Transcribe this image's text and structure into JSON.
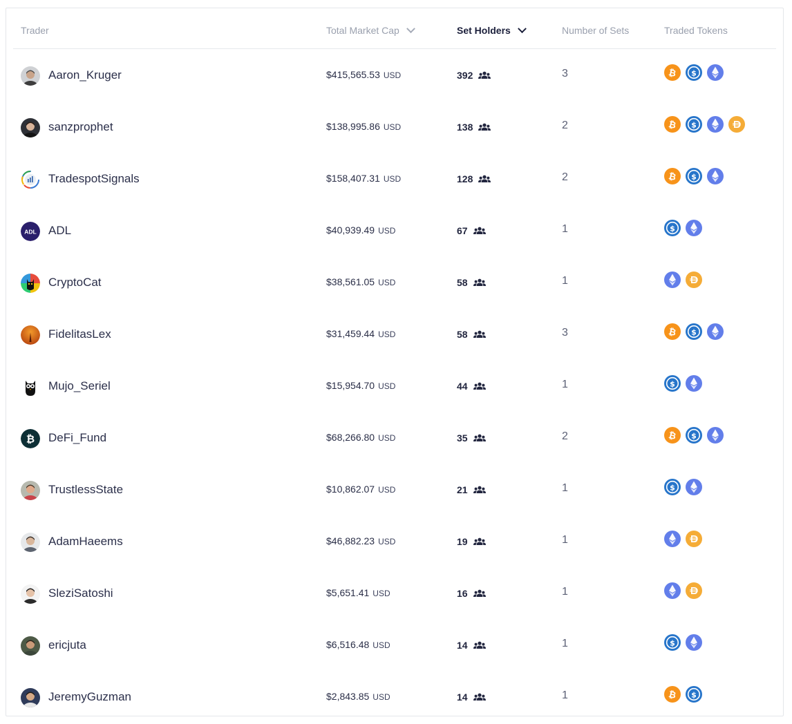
{
  "table": {
    "headers": {
      "trader": "Trader",
      "total_market_cap": "Total Market Cap",
      "set_holders": "Set Holders",
      "number_of_sets": "Number of Sets",
      "traded_tokens": "Traded Tokens"
    },
    "sort_column": "Set Holders",
    "currency_label": "USD",
    "rows": [
      {
        "trader": "Aaron_Kruger",
        "market_cap": "$415,565.53",
        "holders": "392",
        "sets": "3",
        "tokens": [
          "btc",
          "usdc",
          "eth"
        ],
        "avatar": "photo-gray"
      },
      {
        "trader": "sanzprophet",
        "market_cap": "$138,995.86",
        "holders": "138",
        "sets": "2",
        "tokens": [
          "btc",
          "usdc",
          "eth",
          "dai"
        ],
        "avatar": "photo-dark"
      },
      {
        "trader": "TradespotSignals",
        "market_cap": "$158,407.31",
        "holders": "128",
        "sets": "2",
        "tokens": [
          "btc",
          "usdc",
          "eth"
        ],
        "avatar": "ring-logo"
      },
      {
        "trader": "ADL",
        "market_cap": "$40,939.49",
        "holders": "67",
        "sets": "1",
        "tokens": [
          "usdc",
          "eth"
        ],
        "avatar": "adl-logo"
      },
      {
        "trader": "CryptoCat",
        "market_cap": "$38,561.05",
        "holders": "58",
        "sets": "1",
        "tokens": [
          "eth",
          "dai"
        ],
        "avatar": "cat-logo"
      },
      {
        "trader": "FidelitasLex",
        "market_cap": "$31,459.44",
        "holders": "58",
        "sets": "3",
        "tokens": [
          "btc",
          "usdc",
          "eth"
        ],
        "avatar": "orange-logo"
      },
      {
        "trader": "Mujo_Seriel",
        "market_cap": "$15,954.70",
        "holders": "44",
        "sets": "1",
        "tokens": [
          "usdc",
          "eth"
        ],
        "avatar": "owl-logo"
      },
      {
        "trader": "DeFi_Fund",
        "market_cap": "$68,266.80",
        "holders": "35",
        "sets": "2",
        "tokens": [
          "btc",
          "usdc",
          "eth"
        ],
        "avatar": "btc-dark-logo"
      },
      {
        "trader": "TrustlessState",
        "market_cap": "$10,862.07",
        "holders": "21",
        "sets": "1",
        "tokens": [
          "usdc",
          "eth"
        ],
        "avatar": "photo-red"
      },
      {
        "trader": "AdamHaeems",
        "market_cap": "$46,882.23",
        "holders": "19",
        "sets": "1",
        "tokens": [
          "eth",
          "dai"
        ],
        "avatar": "photo-light"
      },
      {
        "trader": "SleziSatoshi",
        "market_cap": "$5,651.41",
        "holders": "16",
        "sets": "1",
        "tokens": [
          "eth",
          "dai"
        ],
        "avatar": "photo-white"
      },
      {
        "trader": "ericjuta",
        "market_cap": "$6,516.48",
        "holders": "14",
        "sets": "1",
        "tokens": [
          "usdc",
          "eth"
        ],
        "avatar": "photo-green"
      },
      {
        "trader": "JeremyGuzman",
        "market_cap": "$2,843.85",
        "holders": "14",
        "sets": "1",
        "tokens": [
          "btc",
          "usdc"
        ],
        "avatar": "photo-blue"
      }
    ]
  },
  "token_colors": {
    "btc": "#f7931a",
    "usdc": "#2775ca",
    "eth": "#627eea",
    "dai": "#f5ac37"
  }
}
